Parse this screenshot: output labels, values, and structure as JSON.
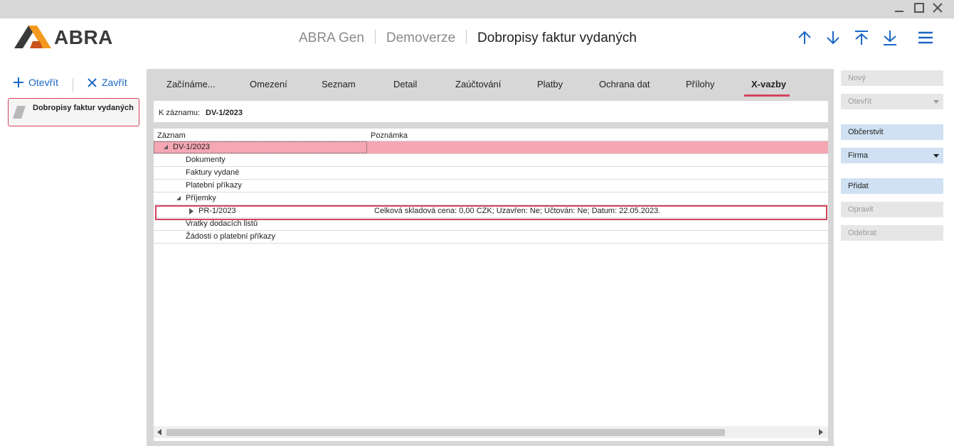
{
  "app": {
    "logo_text": "ABRA"
  },
  "breadcrumbs": [
    "ABRA Gen",
    "Demoverze",
    "Dobropisy faktur vydaných"
  ],
  "left": {
    "open_label": "Otevřít",
    "close_label": "Zavřít",
    "items": [
      {
        "label": "Dobropisy faktur vydaných"
      }
    ]
  },
  "tabs": [
    "Začínáme...",
    "Omezení",
    "Seznam",
    "Detail",
    "Zaúčtování",
    "Platby",
    "Ochrana dat",
    "Přílohy",
    "X-vazby"
  ],
  "active_tab": "X-vazby",
  "record": {
    "label": "K záznamu:",
    "value": "DV-1/2023"
  },
  "grid": {
    "columns": [
      "Záznam",
      "Poznámka"
    ],
    "rows": [
      {
        "text": "DV-1/2023",
        "note": ""
      },
      {
        "text": "Dokumenty",
        "note": ""
      },
      {
        "text": "Faktury vydané",
        "note": ""
      },
      {
        "text": "Platební příkazy",
        "note": ""
      },
      {
        "text": "Příjemky",
        "note": ""
      },
      {
        "text": "PR-1/2023",
        "note": "Celková skladová cena: 0,00 CZK; Uzavřen: Ne; Účtován: Ne; Datum: 22.05.2023."
      },
      {
        "text": "Vratky dodacích listů",
        "note": ""
      },
      {
        "text": "Žádosti o platební příkazy",
        "note": ""
      }
    ]
  },
  "right_buttons": {
    "new": "Nový",
    "open": "Otevřít",
    "refresh": "Občerstvit",
    "firm": "Firma",
    "add": "Přidat",
    "edit": "Opravit",
    "remove": "Odebrat"
  },
  "colors": {
    "accent": "#d2445c",
    "link": "#1b67c4",
    "selection": "#f5a7b4",
    "button_active": "#cfe1f3",
    "logo_orange": "#f39a1e"
  },
  "icons": [
    "minimize-icon",
    "maximize-icon",
    "close-icon",
    "arrow-up-icon",
    "arrow-down-icon",
    "arrow-top-icon",
    "arrow-bottom-icon",
    "menu-icon",
    "plus-icon",
    "x-icon",
    "document-icon",
    "expand-triangle-icon",
    "collapse-triangle-icon",
    "dropdown-icon"
  ]
}
